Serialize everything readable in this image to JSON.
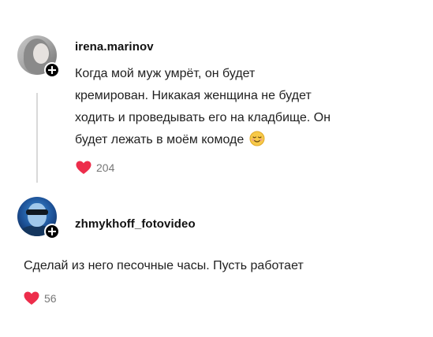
{
  "comments": [
    {
      "username": "irena.marinov",
      "text_lines": [
        "Когда мой муж умрёт, он будет",
        "кремирован. Никакая женщина не будет",
        "ходить и проведывать его на кладбище. Он",
        "будет лежать в моём комоде"
      ],
      "emoji_icon": "relieved-face-emoji-icon",
      "likes": "204"
    },
    {
      "username": "zhmykhoff_fotovideo",
      "text": "Сделай из него песочные часы. Пусть работает",
      "likes": "56"
    }
  ],
  "icons": {
    "follow_badge": "plus-icon",
    "like": "heart-icon"
  },
  "colors": {
    "heart": "#ed2d4b",
    "badge": "#000000",
    "text": "#1f1f1f",
    "muted": "#777777"
  }
}
